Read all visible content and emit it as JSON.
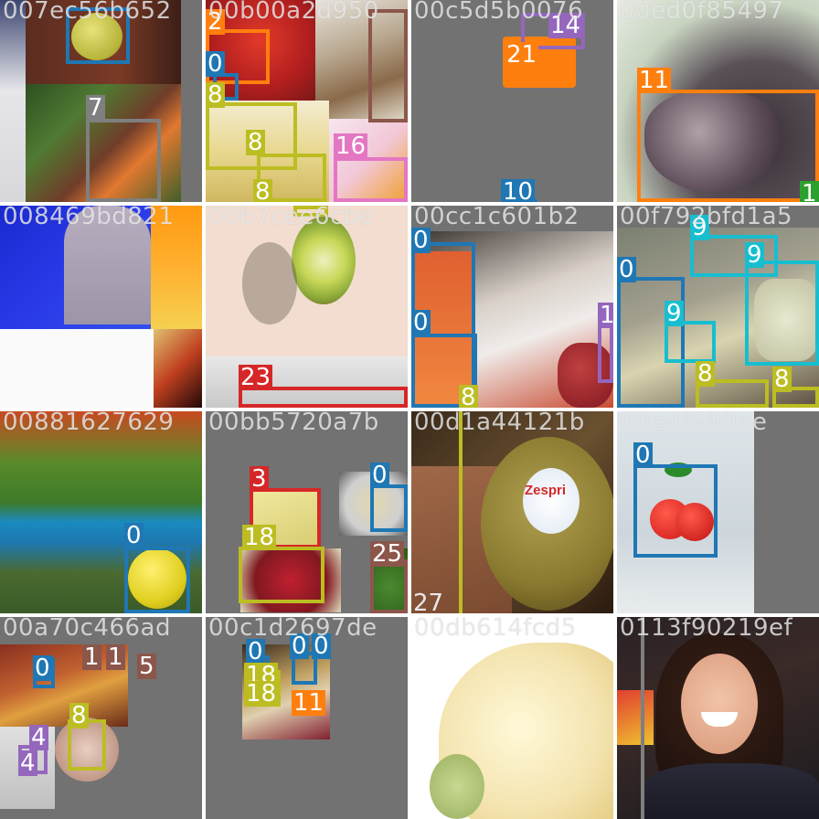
{
  "palette": {
    "c0": "#1f77b4",
    "c3": "#d62728",
    "c4": "#9467bd",
    "c7": "#7f7f7f",
    "c8": "#bcbd22",
    "c9": "#17becf",
    "c10": "#1f77b4",
    "c11": "#ff7f0e",
    "c15": "#8c564b",
    "c16": "#e377c2",
    "c17": "#7f7f7f",
    "c18": "#bcbd22",
    "c21": "#ff7f0e",
    "c23": "#d62728",
    "c25": "#8c564b",
    "c27": "#bcbd22"
  },
  "tiles": [
    {
      "title": "007ec56b652",
      "labels": [
        "7"
      ]
    },
    {
      "title": "00b00a2d950",
      "labels": [
        "2",
        "0",
        "8",
        "8",
        "8",
        "16"
      ]
    },
    {
      "title": "00c5d5b0076",
      "labels": [
        "14",
        "21",
        "10"
      ]
    },
    {
      "title": "00ed0f85497",
      "labels": [
        "11",
        "1"
      ]
    },
    {
      "title": "008469bd821",
      "labels": []
    },
    {
      "title": "00b7cee6cbe",
      "labels": [
        "23"
      ]
    },
    {
      "title": "00cc1c601b2",
      "labels": [
        "0",
        "0",
        "1",
        "8"
      ]
    },
    {
      "title": "00f792bfd1a5",
      "labels": [
        "9",
        "9",
        "0",
        "9",
        "8",
        "8"
      ]
    },
    {
      "title": "00881627629",
      "labels": [
        "0"
      ]
    },
    {
      "title": "00bb5720a7b",
      "labels": [
        "3",
        "0",
        "18",
        "25"
      ]
    },
    {
      "title": "00d1a44121b",
      "labels": [
        "27"
      ],
      "sticker": "Zespri"
    },
    {
      "title": "00e4f590ae",
      "labels": [
        "0",
        "17"
      ]
    },
    {
      "title": "00a70c466ad",
      "labels": [
        "0",
        "1",
        "1",
        "5",
        "8",
        "4",
        "4"
      ]
    },
    {
      "title": "00c1d2697de",
      "labels": [
        "0",
        "0",
        "0",
        "18",
        "18",
        "11"
      ]
    },
    {
      "title": "00db614fcd5",
      "labels": []
    },
    {
      "title": "0113f90219ef",
      "labels": []
    }
  ]
}
